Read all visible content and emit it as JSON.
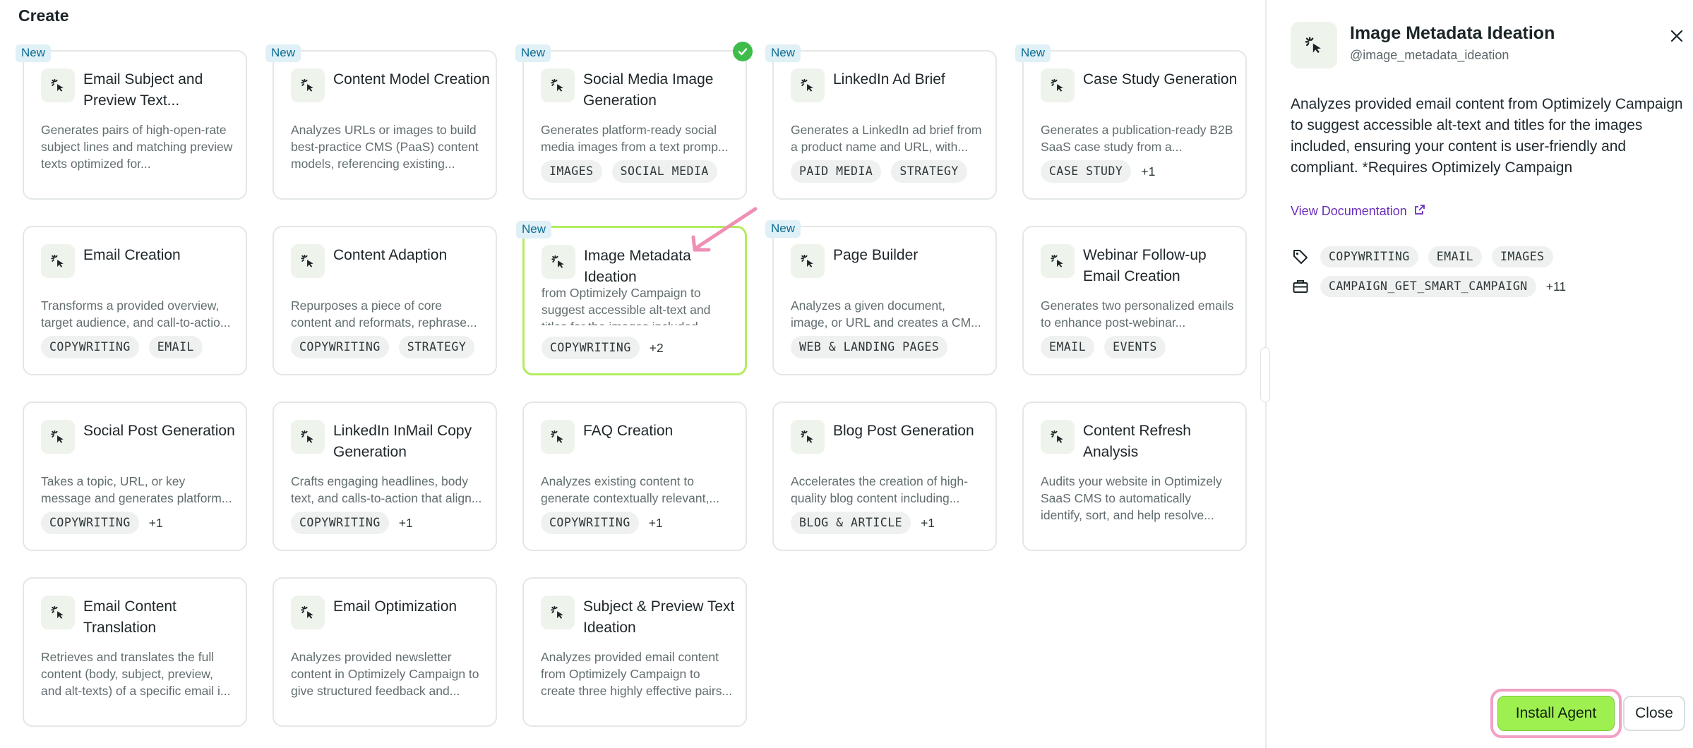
{
  "page": {
    "section_title": "Create"
  },
  "cards": [
    {
      "title": "Email Subject and Preview Text...",
      "desc": "Generates pairs of high-open-rate subject lines and matching preview texts optimized for...",
      "tags": [],
      "more": "",
      "new": "New",
      "check": false,
      "selected": false
    },
    {
      "title": "Content Model Creation",
      "desc": "Analyzes URLs or images to build best-practice CMS (PaaS) content models, referencing existing...",
      "tags": [],
      "more": "",
      "new": "New",
      "check": false,
      "selected": false
    },
    {
      "title": "Social Media Image Generation",
      "desc": "Generates platform-ready social media images from a text promp...",
      "tags": [
        "IMAGES",
        "SOCIAL MEDIA"
      ],
      "more": "",
      "new": "New",
      "check": true,
      "selected": false
    },
    {
      "title": "LinkedIn Ad Brief",
      "desc": "Generates a LinkedIn ad brief from a product name and URL, with...",
      "tags": [
        "PAID MEDIA",
        "STRATEGY"
      ],
      "more": "",
      "new": "New",
      "check": false,
      "selected": false
    },
    {
      "title": "Case Study Generation",
      "desc": "Generates a publication-ready B2B SaaS case study from a...",
      "tags": [
        "CASE STUDY"
      ],
      "more": "+1",
      "new": "New",
      "check": false,
      "selected": false
    },
    {
      "title": "Email Creation",
      "desc": "Transforms a provided overview, target audience, and call-to-actio...",
      "tags": [
        "COPYWRITING",
        "EMAIL"
      ],
      "more": "",
      "new": "",
      "check": false,
      "selected": false
    },
    {
      "title": "Content Adaption",
      "desc": "Repurposes a piece of core content and reformats, rephrase...",
      "tags": [
        "COPYWRITING",
        "STRATEGY"
      ],
      "more": "",
      "new": "",
      "check": false,
      "selected": false
    },
    {
      "title": "Image Metadata Ideation",
      "desc": "from Optimizely Campaign to suggest accessible alt-text and titles for the images included...",
      "tags": [
        "COPYWRITING"
      ],
      "more": "+2",
      "new": "New",
      "check": false,
      "selected": true
    },
    {
      "title": "Page Builder",
      "desc": "Analyzes a given document, image, or URL and creates a CM...",
      "tags": [
        "WEB & LANDING PAGES"
      ],
      "more": "",
      "new": "New",
      "check": false,
      "selected": false
    },
    {
      "title": "Webinar Follow-up Email Creation",
      "desc": "Generates two personalized emails to enhance post-webinar...",
      "tags": [
        "EMAIL",
        "EVENTS"
      ],
      "more": "",
      "new": "",
      "check": false,
      "selected": false
    },
    {
      "title": "Social Post Generation",
      "desc": "Takes a topic, URL, or key message and generates platform...",
      "tags": [
        "COPYWRITING"
      ],
      "more": "+1",
      "new": "",
      "check": false,
      "selected": false
    },
    {
      "title": "LinkedIn InMail Copy Generation",
      "desc": "Crafts engaging headlines, body text, and calls-to-action that align...",
      "tags": [
        "COPYWRITING"
      ],
      "more": "+1",
      "new": "",
      "check": false,
      "selected": false
    },
    {
      "title": "FAQ Creation",
      "desc": "Analyzes existing content to generate contextually relevant,...",
      "tags": [
        "COPYWRITING"
      ],
      "more": "+1",
      "new": "",
      "check": false,
      "selected": false
    },
    {
      "title": "Blog Post Generation",
      "desc": "Accelerates the creation of high-quality blog content including...",
      "tags": [
        "BLOG & ARTICLE"
      ],
      "more": "+1",
      "new": "",
      "check": false,
      "selected": false
    },
    {
      "title": "Content Refresh Analysis",
      "desc": "Audits your website in Optimizely SaaS CMS to automatically identify, sort, and help resolve...",
      "tags": [],
      "more": "",
      "new": "",
      "check": false,
      "selected": false
    },
    {
      "title": "Email Content Translation",
      "desc": "Retrieves and translates the full content (body, subject, preview, and alt-texts) of a specific email i...",
      "tags": [],
      "more": "",
      "new": "",
      "check": false,
      "selected": false
    },
    {
      "title": "Email Optimization",
      "desc": "Analyzes provided newsletter content in Optimizely Campaign to give structured feedback and...",
      "tags": [],
      "more": "",
      "new": "",
      "check": false,
      "selected": false
    },
    {
      "title": "Subject & Preview Text Ideation",
      "desc": "Analyzes provided email content from Optimizely Campaign to create three highly effective pairs...",
      "tags": [],
      "more": "",
      "new": "",
      "check": false,
      "selected": false
    }
  ],
  "panel": {
    "title": "Image Metadata Ideation",
    "handle": "@image_metadata_ideation",
    "description": "Analyzes provided email content from Optimizely Campaign to suggest accessible alt-text and titles for the images included, ensuring your content is user-friendly and compliant. *Requires Optimizely Campaign",
    "doc_link": "View Documentation",
    "tags": [
      "COPYWRITING",
      "EMAIL",
      "IMAGES"
    ],
    "tools": [
      "CAMPAIGN_GET_SMART_CAMPAIGN"
    ],
    "tools_more": "+11",
    "install_label": "Install Agent",
    "close_label": "Close"
  },
  "colors": {
    "accent_green": "#9ef051",
    "selected_border": "#b2ec5f",
    "highlight_pink": "#f2a0c5",
    "new_badge_bg": "#dff0f6",
    "new_badge_text": "#0d6c93",
    "link": "#6a2dbb",
    "check": "#3fbd4a"
  },
  "icons": {
    "card": "cursor-sparkle-icon",
    "check": "check-circle-icon",
    "tag": "tag-icon",
    "tools": "toolbox-icon",
    "external": "external-link-icon",
    "close": "close-icon"
  }
}
